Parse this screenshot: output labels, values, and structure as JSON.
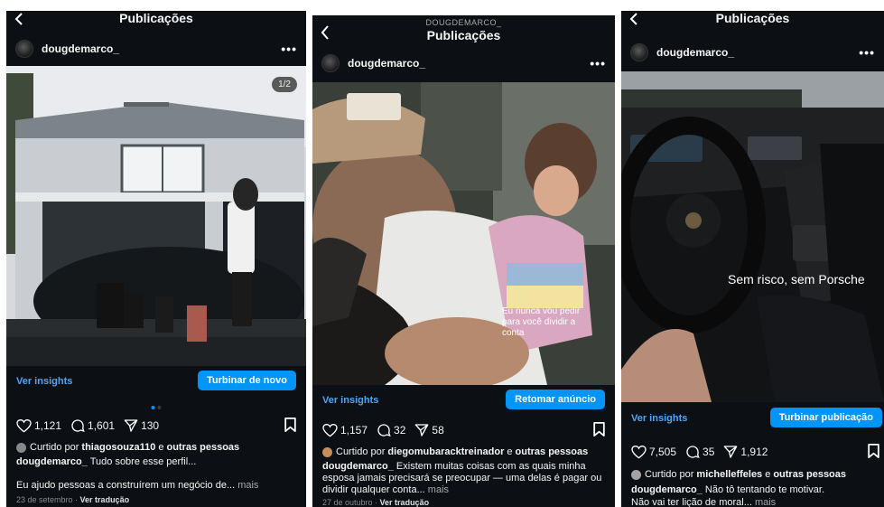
{
  "posts": [
    {
      "header": {
        "title": "Publicações",
        "subtitle": ""
      },
      "username": "dougdemarco_",
      "image_counter": "1/2",
      "insights_label": "Ver insights",
      "boost_label": "Turbinar de novo",
      "likes": "1,121",
      "comments": "1,601",
      "shares": "130",
      "liked_prefix": "Curtido por",
      "liked_user": "thiagosouza110",
      "liked_mid": "e",
      "liked_others": "outras pessoas",
      "caption_user": "dougdemarco_",
      "caption_text": "Tudo sobre esse perfil...",
      "caption_line2": "Eu ajudo pessoas a construírem um negócio de...",
      "more_label": "mais",
      "date": "23 de setembro",
      "translate_label": "Ver tradução"
    },
    {
      "header": {
        "title": "Publicações",
        "subtitle": "DOUGDEMARCO_"
      },
      "username": "dougdemarco_",
      "overlay_text": "Eu nunca vou pedir para você dividir a conta",
      "insights_label": "Ver insights",
      "boost_label": "Retomar anúncio",
      "likes": "1,157",
      "comments": "32",
      "shares": "58",
      "liked_prefix": "Curtido por",
      "liked_user": "diegomubaracktreinador",
      "liked_mid": "e",
      "liked_others": "outras pessoas",
      "caption_user": "dougdemarco_",
      "caption_text": "Existem muitas coisas com as quais minha esposa jamais precisará se preocupar — uma delas é pagar ou dividir qualquer conta...",
      "more_label": "mais",
      "date": "27 de outubro",
      "translate_label": "Ver tradução"
    },
    {
      "header": {
        "title": "Publicações",
        "subtitle": ""
      },
      "username": "dougdemarco_",
      "overlay_text": "Sem risco, sem Porsche",
      "insights_label": "Ver insights",
      "boost_label": "Turbinar publicação",
      "likes": "7,505",
      "comments": "35",
      "shares": "1,912",
      "liked_prefix": "Curtido por",
      "liked_user": "michelleffeles",
      "liked_mid": "e",
      "liked_others": "outras pessoas",
      "caption_user": "dougdemarco_",
      "caption_text": "Não tô tentando te motivar.",
      "caption_line2": "Não vai ter lição de moral...",
      "more_label": "mais"
    }
  ],
  "icons": [
    "chevron-left-icon",
    "more-icon",
    "heart-icon",
    "comment-icon",
    "share-icon",
    "bookmark-icon"
  ],
  "colors": {
    "background": "#0c1014",
    "accent": "#0095f6",
    "link": "#4ea5f5",
    "text": "#f5f5f5",
    "muted": "#a8a8a8"
  }
}
